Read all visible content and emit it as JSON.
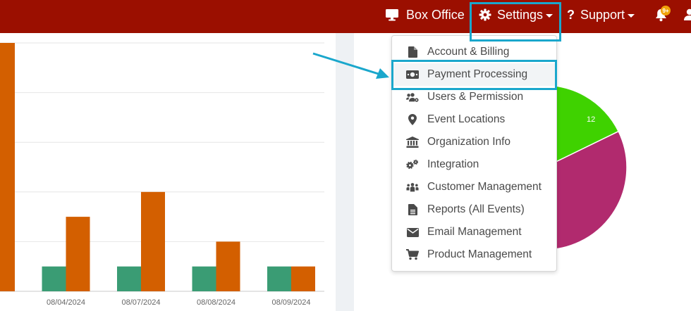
{
  "nav": {
    "box_office_label": "Box Office",
    "settings_label": "Settings",
    "support_label": "Support",
    "notification_badge": "9+"
  },
  "settings_menu": {
    "items": [
      {
        "label": "Account & Billing",
        "icon": "file-icon"
      },
      {
        "label": "Payment Processing",
        "icon": "money-bill-icon"
      },
      {
        "label": "Users & Permission",
        "icon": "users-cog-icon"
      },
      {
        "label": "Event Locations",
        "icon": "map-marker-icon"
      },
      {
        "label": "Organization Info",
        "icon": "landmark-icon"
      },
      {
        "label": "Integration",
        "icon": "cogs-icon"
      },
      {
        "label": "Customer Management",
        "icon": "people-group-icon"
      },
      {
        "label": "Reports (All Events)",
        "icon": "file-alt-icon"
      },
      {
        "label": "Email Management",
        "icon": "envelope-icon"
      },
      {
        "label": "Product Management",
        "icon": "shopping-cart-icon"
      }
    ],
    "highlighted_item": "Payment Processing"
  },
  "colors": {
    "topbar": "#9b0f00",
    "series_green": "#3a9c74",
    "series_orange": "#d35f00",
    "pie_green": "#3fd200",
    "pie_magenta": "#b12a6e",
    "highlight": "#1aa7cc"
  },
  "chart_data": [
    {
      "type": "bar",
      "categories": [
        "",
        "08/04/2024",
        "08/07/2024",
        "08/08/2024",
        "08/09/2024"
      ],
      "category_labels_visible": [
        "024",
        "08/04/2024",
        "08/07/2024",
        "08/08/2024",
        "08/09/2024"
      ],
      "ylim": [
        0,
        5
      ],
      "grid": true,
      "series": [
        {
          "color": "#3a9c74",
          "values": [
            null,
            0.5,
            0.5,
            0.5,
            0.5
          ]
        },
        {
          "color": "#d35f00",
          "values": [
            5,
            1.5,
            2,
            1,
            0.5
          ]
        }
      ]
    },
    {
      "type": "pie",
      "slices": [
        {
          "label": "12",
          "color": "#3fd200"
        },
        {
          "label": "",
          "color": "#b12a6e"
        }
      ]
    }
  ]
}
